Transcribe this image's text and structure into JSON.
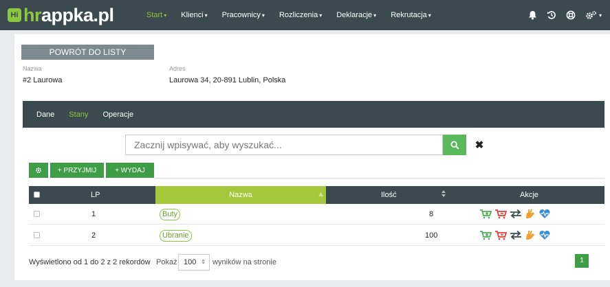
{
  "brand": {
    "badge": "Hi",
    "name_a": "hr",
    "name_b": "appka.pl"
  },
  "nav": {
    "items": [
      {
        "label": "Start",
        "active": true
      },
      {
        "label": "Klienci",
        "active": false
      },
      {
        "label": "Pracownicy",
        "active": false
      },
      {
        "label": "Rozliczenia",
        "active": false
      },
      {
        "label": "Deklaracje",
        "active": false
      },
      {
        "label": "Rekrutacja",
        "active": false
      }
    ],
    "icons": [
      "bell-icon",
      "history-icon",
      "lifebuoy-icon",
      "settings-icon"
    ],
    "caret": "▾"
  },
  "back_button": "POWRÓT DO LISTY",
  "fields": {
    "name_label": "Nazwa",
    "name_value": "#2 Laurowa",
    "address_label": "Adres",
    "address_value": "Laurowa 34, 20-891 Lublin, Polska"
  },
  "tabs": [
    {
      "label": "Dane",
      "active": false
    },
    {
      "label": "Stany",
      "active": true
    },
    {
      "label": "Operacje",
      "active": false
    }
  ],
  "search": {
    "placeholder": "Zacznij wpisywać, aby wyszukać...",
    "value": "",
    "clear": "✖"
  },
  "toolbar": {
    "accept_label": "+ PRZYJMIJ",
    "issue_label": "+ WYDAJ"
  },
  "table": {
    "columns": {
      "lp": "LP",
      "name": "Nazwa",
      "qty": "Ilość",
      "actions": "Akcje"
    },
    "rows": [
      {
        "lp": "1",
        "name": "Buty",
        "qty": "8"
      },
      {
        "lp": "2",
        "name": "Ubranie",
        "qty": "100"
      }
    ]
  },
  "footer": {
    "summary": "Wyświetlono od 1 do 2 z 2 rekordów",
    "show_label": "Pokaż",
    "per_page": "100",
    "per_page_suffix": "wyników na stronie",
    "current_page": "1"
  },
  "colors": {
    "navbar": "#3a4a4f",
    "accent": "#8dc63f",
    "button_green": "#3f9e45",
    "sort_header": "#a6c73c",
    "back_button": "#7d8a90"
  }
}
